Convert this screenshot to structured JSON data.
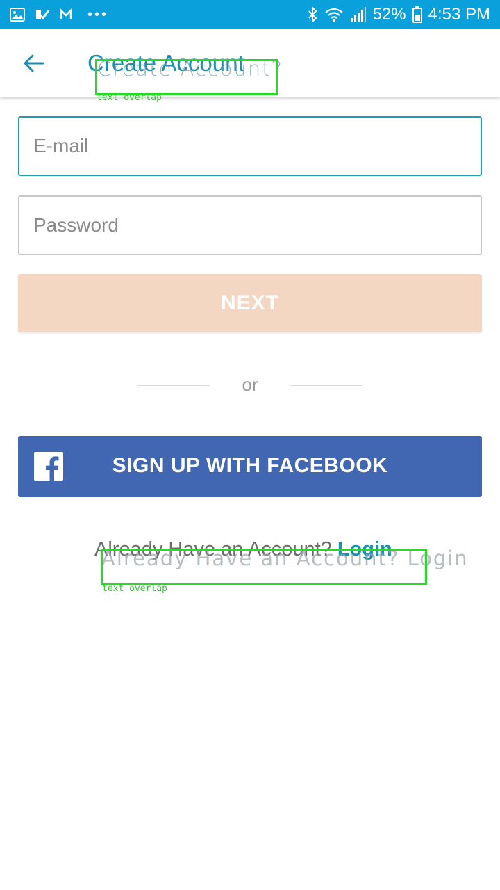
{
  "status_bar": {
    "battery": "52%",
    "time": "4:53 PM",
    "notification_dots": "•••",
    "left_icons": [
      "image-icon",
      "check-icon",
      "gmail-icon"
    ],
    "right_icons": [
      "bluetooth-icon",
      "wifi-icon",
      "signal-icon",
      "battery-icon"
    ],
    "background": "#0aa0dc"
  },
  "app_bar": {
    "title": "Create Account",
    "title_overlay": "Create Account?",
    "back_icon": "arrow-left-icon"
  },
  "form": {
    "email_placeholder": "E-mail",
    "email_value": "",
    "password_placeholder": "Password",
    "password_value": "",
    "next_label": "NEXT",
    "or_label": "or",
    "facebook_label": "SIGN UP WITH FACEBOOK",
    "facebook_icon": "facebook-icon"
  },
  "footer": {
    "already_text": "Already Have an Account?",
    "login_label": "Login",
    "overlay_text": "Already Have an Account? Login"
  },
  "overlays": {
    "label": "text overlap"
  },
  "colors": {
    "accent": "#1a8fb0",
    "next_button": "#f3d7c3",
    "facebook": "#4267b2",
    "overlay_box": "#22dd22"
  }
}
